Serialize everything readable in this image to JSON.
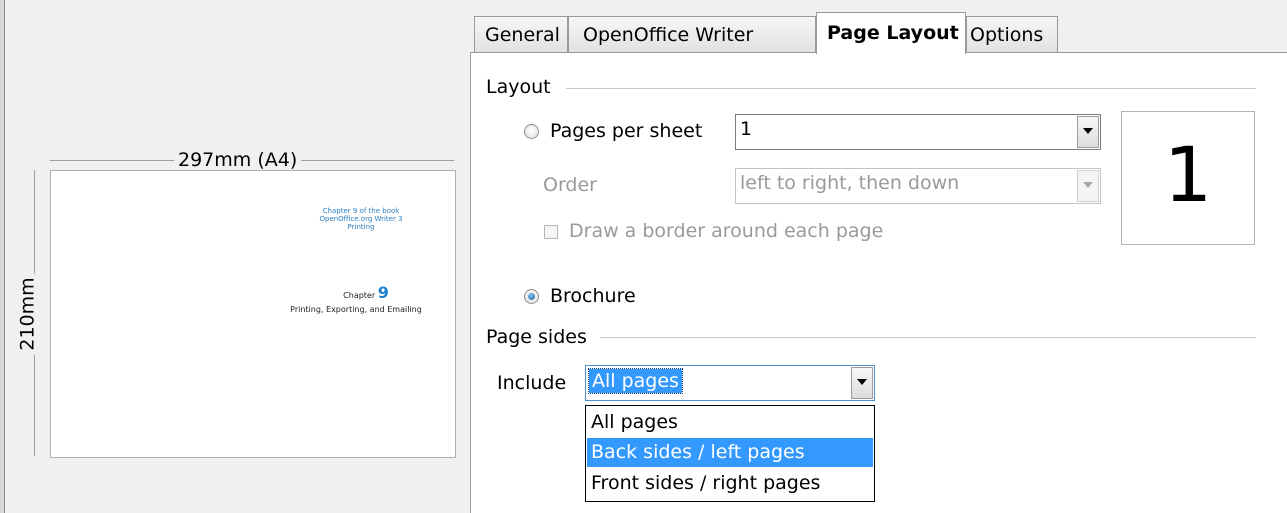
{
  "preview": {
    "width_label": "297mm (A4)",
    "height_label": "210mm",
    "thumb_lines": [
      "Chapter 9 of the book",
      "OpenOffice.org Writer 3",
      "Printing"
    ],
    "thumb_chapter": "Chapter",
    "thumb_chapter_num": "9",
    "thumb_subtitle": "Printing, Exporting, and Emailing"
  },
  "tabs": [
    {
      "label": "General"
    },
    {
      "label": "OpenOffice Writer"
    },
    {
      "label": "Page Layout"
    },
    {
      "label": "Options"
    }
  ],
  "layout": {
    "section_label": "Layout",
    "pages_per_sheet": {
      "label": "Pages per sheet",
      "value": "1",
      "checked": false
    },
    "order": {
      "label": "Order",
      "value": "left to right, then down"
    },
    "border_checkbox": {
      "label": "Draw a border around each page"
    },
    "brochure": {
      "label": "Brochure",
      "checked": true
    },
    "preview_number": "1"
  },
  "page_sides": {
    "section_label": "Page sides",
    "include_label": "Include",
    "include_value": "All pages",
    "options": [
      "All pages",
      "Back sides / left pages",
      "Front sides / right pages"
    ],
    "highlighted_option": "Back sides / left pages"
  },
  "colors": {
    "selection": "#3399ff",
    "radio_checked": "#1e5e94"
  }
}
